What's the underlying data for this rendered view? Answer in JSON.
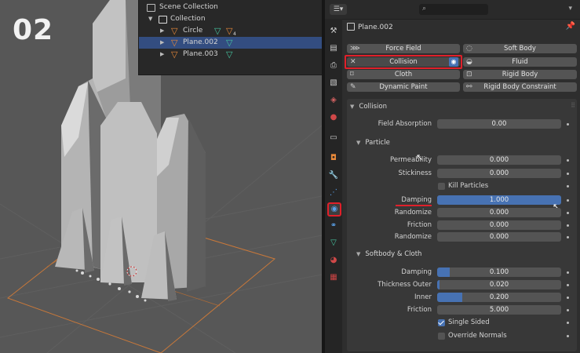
{
  "step_label": "02",
  "outliner": {
    "root": "Scene Collection",
    "items": [
      {
        "label": "Collection"
      },
      {
        "label": "Circle",
        "modifier_count": "4"
      },
      {
        "label": "Plane.002"
      },
      {
        "label": "Plane.003"
      }
    ]
  },
  "properties": {
    "object_name": "Plane.002",
    "physics_buttons": [
      {
        "label": "Force Field",
        "icon": "force-field-icon"
      },
      {
        "label": "Soft Body",
        "icon": "soft-body-icon"
      },
      {
        "label": "Collision",
        "icon": "close-icon"
      },
      {
        "label": "Fluid",
        "icon": "fluid-icon"
      },
      {
        "label": "Cloth",
        "icon": "cloth-icon"
      },
      {
        "label": "Rigid Body",
        "icon": "rigid-body-icon"
      },
      {
        "label": "Dynamic Paint",
        "icon": "dynamic-paint-icon"
      },
      {
        "label": "Rigid Body Constraint",
        "icon": "rigid-body-constraint-icon"
      }
    ],
    "collision": {
      "title": "Collision",
      "field_absorption": {
        "label": "Field Absorption",
        "value": "0.00"
      },
      "particle": {
        "title": "Particle",
        "permeability": {
          "label": "Permeability",
          "value": "0.000"
        },
        "stickiness": {
          "label": "Stickiness",
          "value": "0.000"
        },
        "kill_particles": {
          "label": "Kill Particles",
          "checked": false
        },
        "damping": {
          "label": "Damping",
          "value": "1.000",
          "fraction": 1.0
        },
        "damping_randomize": {
          "label": "Randomize",
          "value": "0.000"
        },
        "friction": {
          "label": "Friction",
          "value": "0.000"
        },
        "friction_randomize": {
          "label": "Randomize",
          "value": "0.000"
        }
      },
      "softbody_cloth": {
        "title": "Softbody & Cloth",
        "damping": {
          "label": "Damping",
          "value": "0.100",
          "fraction": 0.1
        },
        "thickness_outer": {
          "label": "Thickness Outer",
          "value": "0.020",
          "fraction": 0.02
        },
        "inner": {
          "label": "Inner",
          "value": "0.200",
          "fraction": 0.2
        },
        "friction": {
          "label": "Friction",
          "value": "5.000"
        },
        "single_sided": {
          "label": "Single Sided",
          "checked": true
        },
        "override_normals": {
          "label": "Override Normals",
          "checked": false
        }
      }
    }
  },
  "colors": {
    "accent": "#4772b3",
    "highlight_red": "#e0202a",
    "outliner_selection": "#334d80"
  }
}
